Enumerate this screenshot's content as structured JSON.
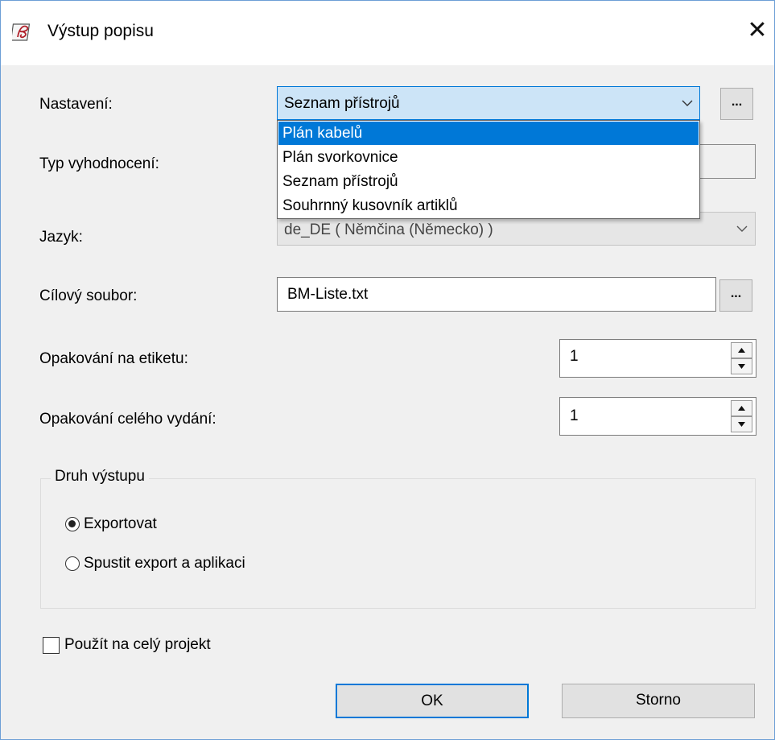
{
  "window": {
    "title": "Výstup popisu",
    "close_glyph": "✕",
    "app_icon": "descriptive-output-icon"
  },
  "form": {
    "settings_label": "Nastavení:",
    "settings_value": "Seznam přístrojů",
    "settings_button": "...",
    "eval_type_label": "Typ vyhodnocení:",
    "language_label": "Jazyk:",
    "language_value": "de_DE ( Němčina (Německo) )",
    "target_label": "Cílový soubor:",
    "target_value": "BM-Liste.txt",
    "target_button": "...",
    "rep_label_label": "Opakování na etiketu:",
    "rep_label_value": "1",
    "rep_all_label": "Opakování celého vydání:",
    "rep_all_value": "1"
  },
  "dropdown": {
    "options": [
      "Plán kabelů",
      "Plán svorkovnice",
      "Seznam přístrojů",
      "Souhrnný kusovník artiklů"
    ],
    "highlighted": "Plán kabelů"
  },
  "output_type": {
    "title": "Druh výstupu",
    "option_export": "Exportovat",
    "option_export_launch": "Spustit export a aplikaci",
    "selected": "Exportovat"
  },
  "apply_whole_project": {
    "label": "Použít na celý projekt",
    "checked": false
  },
  "buttons": {
    "ok": "OK",
    "cancel": "Storno"
  },
  "colors": {
    "accent": "#0078d7",
    "combo_focus": "#cce4f7",
    "window_border": "#6d9fd6"
  }
}
